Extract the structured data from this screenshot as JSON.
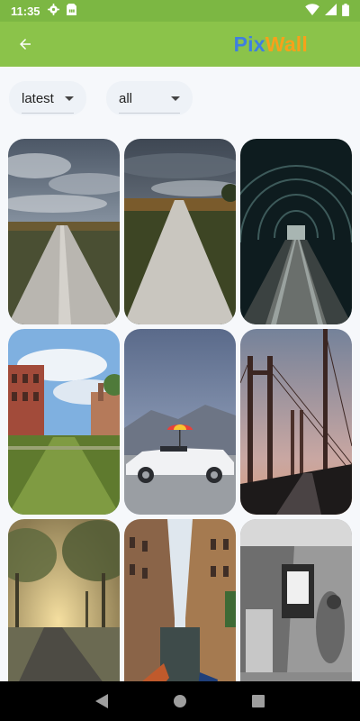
{
  "status_bar": {
    "time": "11:35",
    "left_icons": [
      "settings-icon",
      "sim-card-icon"
    ],
    "right_icons": [
      "wifi-icon",
      "signal-icon",
      "battery-icon"
    ]
  },
  "app_bar": {
    "back_icon": "arrow-back-icon",
    "brand_part1": "Pix",
    "brand_part2": "Wall",
    "brand_color1": "#3f7fe0",
    "brand_color2": "#f7a11a",
    "bar_color": "#8bc34a"
  },
  "filters": {
    "sort": {
      "value": "latest"
    },
    "category": {
      "value": "all"
    }
  },
  "gallery": {
    "wallpapers": [
      "cloudy-road-wallpaper",
      "road-horizon-wallpaper",
      "tunnel-railway-wallpaper",
      "street-buildings-wallpaper",
      "convertible-car-wallpaper",
      "bridge-sunset-wallpaper",
      "misty-tree-road-wallpaper",
      "venice-canal-wallpaper",
      "monochrome-street-wallpaper"
    ]
  },
  "nav_bar": {
    "icons": [
      "back-triangle-icon",
      "home-circle-icon",
      "recents-square-icon"
    ]
  }
}
